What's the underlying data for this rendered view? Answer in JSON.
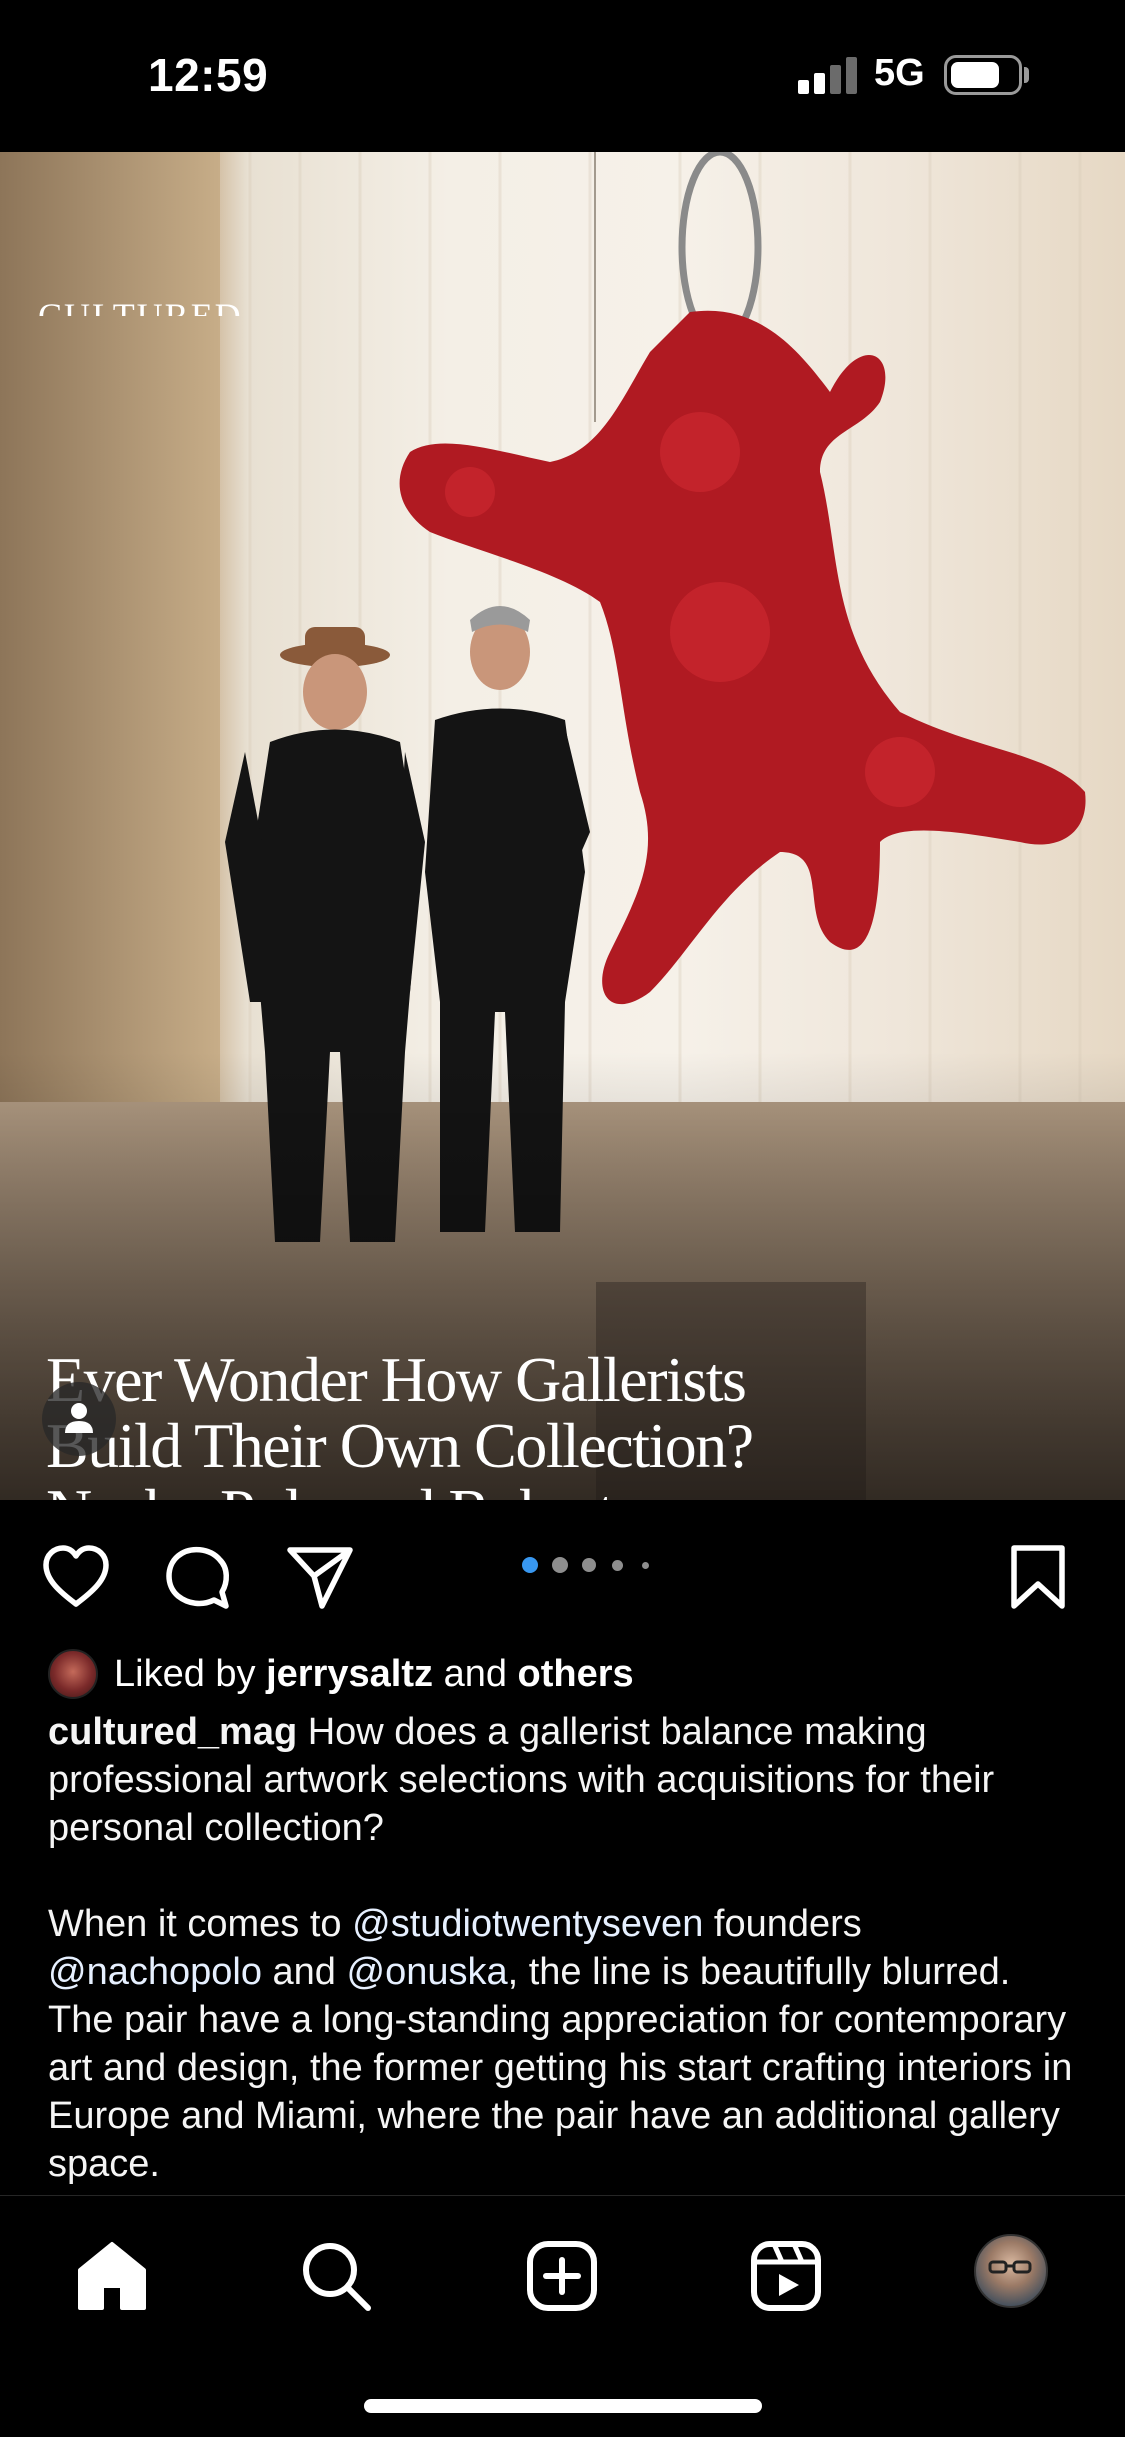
{
  "status_bar": {
    "time": "12:59",
    "network": "5G",
    "signal_bars_active": 2,
    "signal_bars_total": 4,
    "battery_level": 0.75
  },
  "post": {
    "brand": "CULTURED",
    "headline": "Ever Wonder How Gallerists\nBuild Their Own Collection?\nNacho Polo and Robert\nOnuska Tell All",
    "carousel": {
      "total_dots": 5,
      "active_index": 0
    },
    "icons": {
      "like": "heart-icon",
      "comment": "comment-bubble-icon",
      "share": "paper-plane-icon",
      "save": "bookmark-icon",
      "tag": "person-tag-icon"
    },
    "likes": {
      "prefix": "Liked by",
      "user": "jerrysaltz",
      "connector": "and",
      "others": "others"
    },
    "caption": {
      "username": "cultured_mag",
      "text": "How does a gallerist balance making professional artwork selections with acquisitions for their personal collection?",
      "p2_1": "When it comes to",
      "mention1": "@studiotwentyseven",
      "p2_2": "founders",
      "mention2": "@nachopolo",
      "p2_3": "and",
      "mention3": "@onuska",
      "p2_4": ", the line is beautifully blurred. The pair have a long-standing appreciation for contemporary art and design, the former getting his start crafting interiors in Europe and Miami, where the pair have an additional gallery space."
    }
  },
  "nav": {
    "home": "home-icon",
    "search": "search-icon",
    "create": "add-post-icon",
    "reels": "reels-icon",
    "profile": "profile-avatar"
  },
  "colors": {
    "background": "#000000",
    "text": "#ffffff",
    "active_dot": "#3897f0",
    "inactive_dot": "#8e8e8e"
  }
}
